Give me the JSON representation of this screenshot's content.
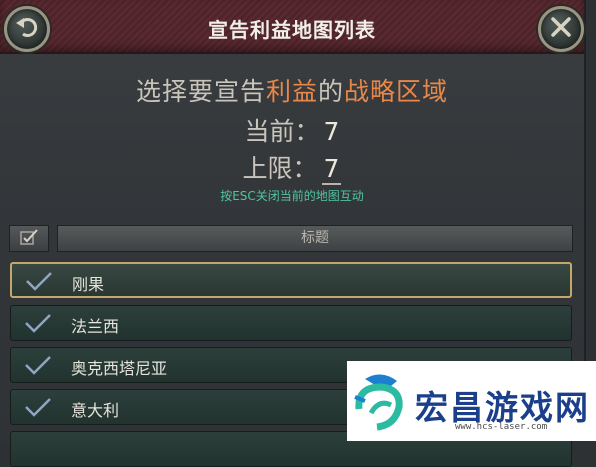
{
  "window": {
    "title": "宣告利益地图列表"
  },
  "prompt": {
    "part1": "选择要宣告",
    "highlight1": "利益",
    "part2": "的",
    "highlight2": "战略区域"
  },
  "stats": {
    "current_label": "当前：",
    "current_value": "7",
    "limit_label": "上限：",
    "limit_value": "7"
  },
  "hint": "按ESC关闭当前的地图互动",
  "table": {
    "column_title": "标题",
    "rows": [
      {
        "name": "刚果",
        "checked": true,
        "selected": true
      },
      {
        "name": "法兰西",
        "checked": true,
        "selected": false
      },
      {
        "name": "奥克西塔尼亚",
        "checked": true,
        "selected": false
      },
      {
        "name": "意大利",
        "checked": true,
        "selected": false
      }
    ]
  },
  "watermark": {
    "brand": "宏昌游戏网",
    "url": "www.hcs-laser.com"
  },
  "colors": {
    "accent_orange": "#e8874a",
    "hint_green": "#4fc6a0",
    "title_bar": "#5a2a30",
    "selected_border": "#c4a76a"
  },
  "icons": {
    "back": "back-arrow-icon",
    "close": "close-x-icon",
    "row_check": "checkmark-icon",
    "select_all": "checkbox-icon"
  }
}
